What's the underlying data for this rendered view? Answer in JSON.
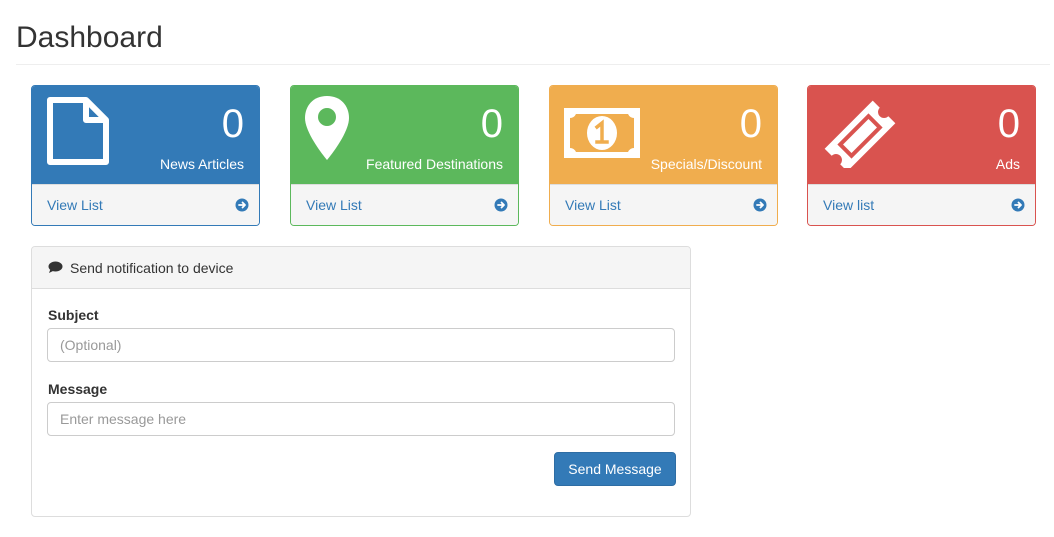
{
  "page": {
    "title": "Dashboard"
  },
  "stats": [
    {
      "value": "0",
      "label": "News Articles",
      "link": "View List",
      "icon": "file-icon",
      "color": "#337ab7"
    },
    {
      "value": "0",
      "label": "Featured Destinations",
      "link": "View List",
      "icon": "map-marker-icon",
      "color": "#5cb85c"
    },
    {
      "value": "0",
      "label": "Specials/Discount",
      "link": "View List",
      "icon": "money-icon",
      "color": "#f0ad4e"
    },
    {
      "value": "0",
      "label": "Ads",
      "link": "View list",
      "icon": "ticket-icon",
      "color": "#d9534f"
    }
  ],
  "notification": {
    "title": "Send notification to device",
    "icon": "comment-icon",
    "subject_label": "Subject",
    "subject_placeholder": "(Optional)",
    "message_label": "Message",
    "message_placeholder": "Enter message here",
    "send_label": "Send Message"
  }
}
